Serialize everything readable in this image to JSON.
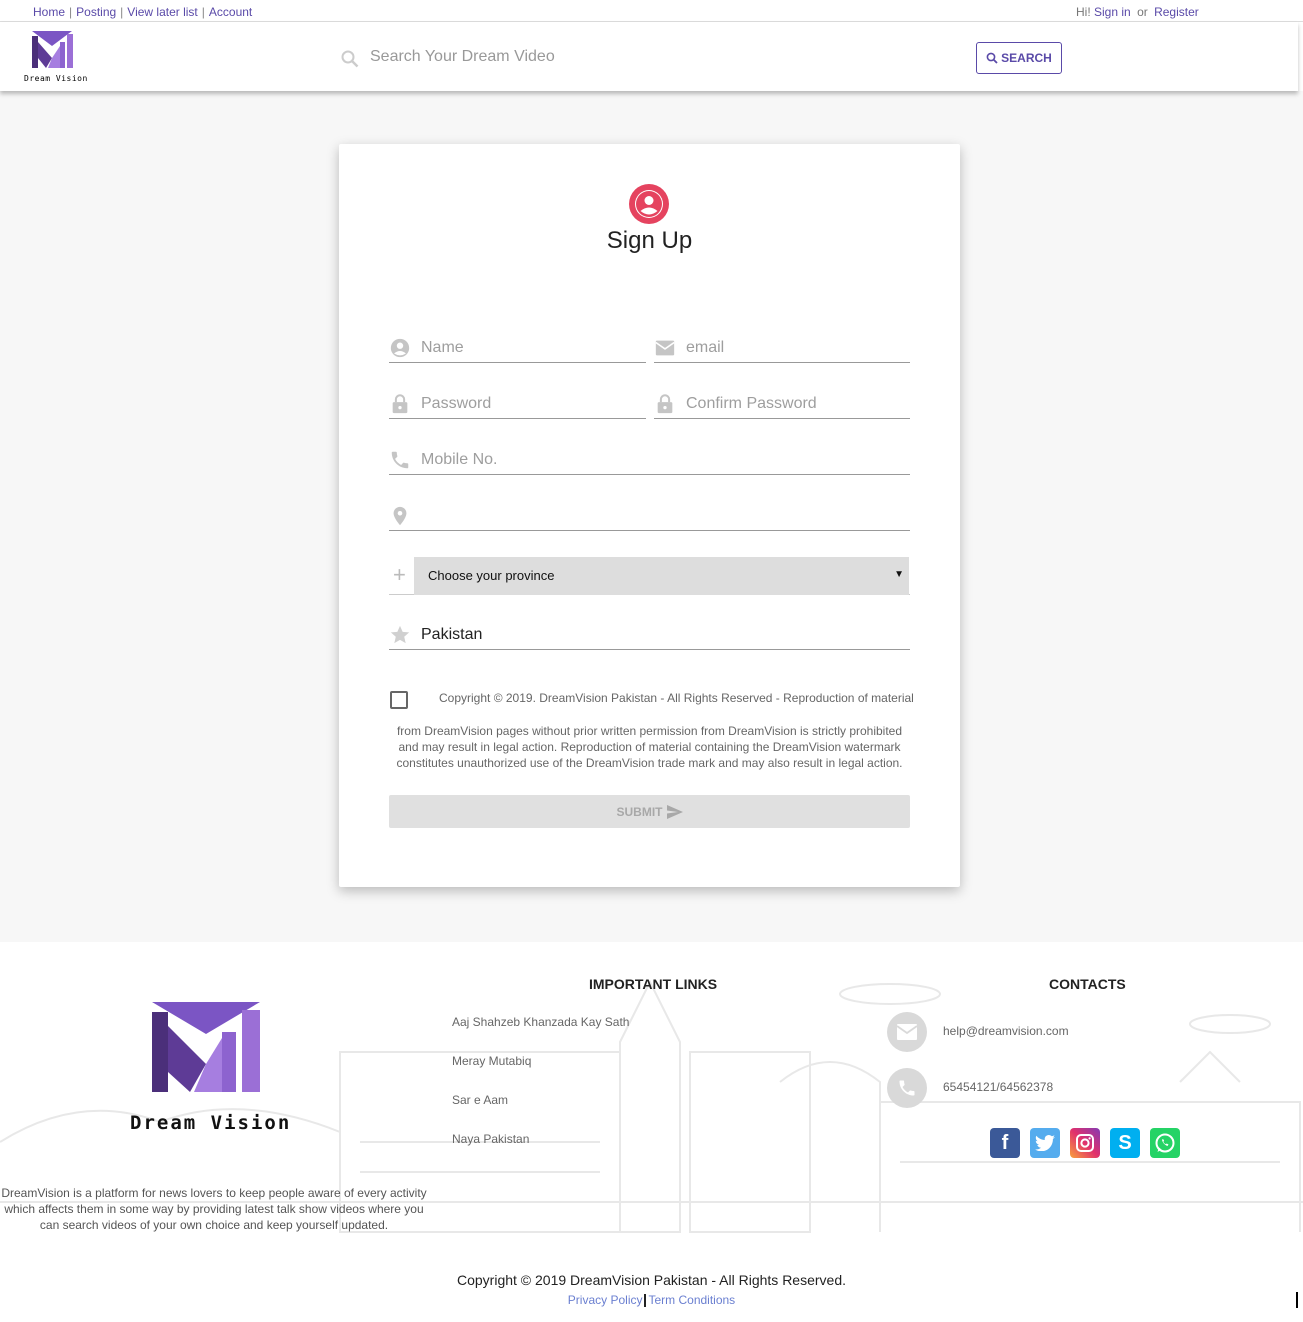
{
  "topbar": {
    "links": [
      "Home",
      "Posting",
      "View later list",
      "Account"
    ],
    "greeting": "Hi!",
    "sign_in": "Sign in",
    "or": "or",
    "register": "Register"
  },
  "header": {
    "logo_text": "Dream Vision",
    "search_placeholder": "Search Your Dream Video",
    "search_button": "SEARCH"
  },
  "signup": {
    "title": "Sign Up",
    "name_placeholder": "Name",
    "email_placeholder": "email",
    "password_placeholder": "Password",
    "confirm_password_placeholder": "Confirm Password",
    "mobile_placeholder": "Mobile No.",
    "address_value": "",
    "province_selected": "Choose your province",
    "country_value": "Pakistan",
    "terms_line1": "Copyright © 2019. DreamVision Pakistan - All Rights Reserved - Reproduction of material",
    "terms_rest": "from DreamVision pages without prior written permission from DreamVision is strictly prohibited and may result in legal action. Reproduction of material containing the DreamVision watermark constitutes unauthorized use of the DreamVision trade mark and may also result in legal action.",
    "submit_label": "SUBMIT"
  },
  "footer": {
    "brand": "Dream Vision",
    "description": "DreamVision is a platform for news lovers to keep people aware of every activity which affects them in some way by providing latest talk show videos where you can search videos of your own choice and keep yourself updated.",
    "links_title": "IMPORTANT LINKS",
    "links": [
      "Aaj Shahzeb Khanzada Kay Sath",
      "Meray Mutabiq",
      "Sar e Aam",
      "Naya Pakistan"
    ],
    "contacts_title": "CONTACTS",
    "email": "help@dreamvision.com",
    "phone": "65454121/64562378",
    "social": [
      "facebook",
      "twitter",
      "instagram",
      "skype",
      "whatsapp"
    ],
    "colors": {
      "facebook": "#3b5998",
      "twitter": "#55acee",
      "instagram": "#c13584",
      "skype": "#00aff0",
      "whatsapp": "#25d366"
    }
  },
  "bottom": {
    "copyright": "Copyright © 2019 DreamVision Pakistan - All Rights Reserved.",
    "privacy": "Privacy Policy",
    "terms": "Term Conditions"
  },
  "colors": {
    "accent": "#5a4aa8",
    "avatar": "#e5435f",
    "logo_dark": "#4b2f7a",
    "logo_light": "#9b6fd6"
  }
}
